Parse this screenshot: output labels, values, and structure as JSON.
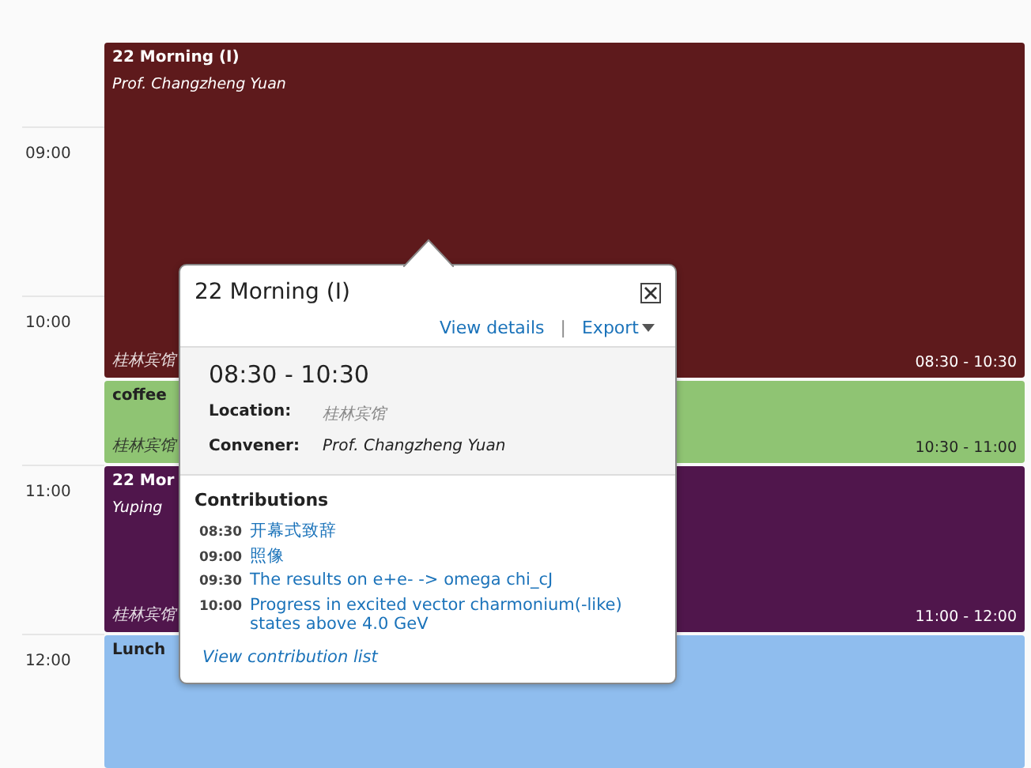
{
  "hours": [
    "09:00",
    "10:00",
    "11:00",
    "12:00"
  ],
  "blocks": [
    {
      "title": "22 Morning (I)",
      "subtitle": "Prof. Changzheng Yuan",
      "location": "桂林宾馆",
      "time": "08:30 - 10:30",
      "color": "#5e1a1c"
    },
    {
      "title": "coffee",
      "location": "桂林宾馆",
      "time": "10:30 - 11:00",
      "color": "#8fc473"
    },
    {
      "title": "22 Mor",
      "subtitle": "Yuping",
      "location": "桂林宾馆",
      "time": "11:00 - 12:00",
      "color": "#50164c"
    },
    {
      "title": "Lunch",
      "color": "#8fbdee"
    }
  ],
  "popup": {
    "title": "22 Morning (I)",
    "links": [
      "View details",
      "Export"
    ],
    "separator": "|",
    "time": "08:30 - 10:30",
    "fields": [
      {
        "label": "Location:",
        "value": "桂林宾馆"
      },
      {
        "label": "Convener:",
        "value": "Prof. Changzheng Yuan"
      }
    ],
    "contributions_title": "Contributions",
    "contributions": [
      {
        "time": "08:30",
        "title": "开幕式致辞"
      },
      {
        "time": "09:00",
        "title": "照像"
      },
      {
        "time": "09:30",
        "title": "The results on e+e- -> omega chi_cJ"
      },
      {
        "time": "10:00",
        "title": "Progress in excited vector charmonium(-like) states above 4.0 GeV"
      }
    ],
    "footer_link": "View contribution list"
  }
}
